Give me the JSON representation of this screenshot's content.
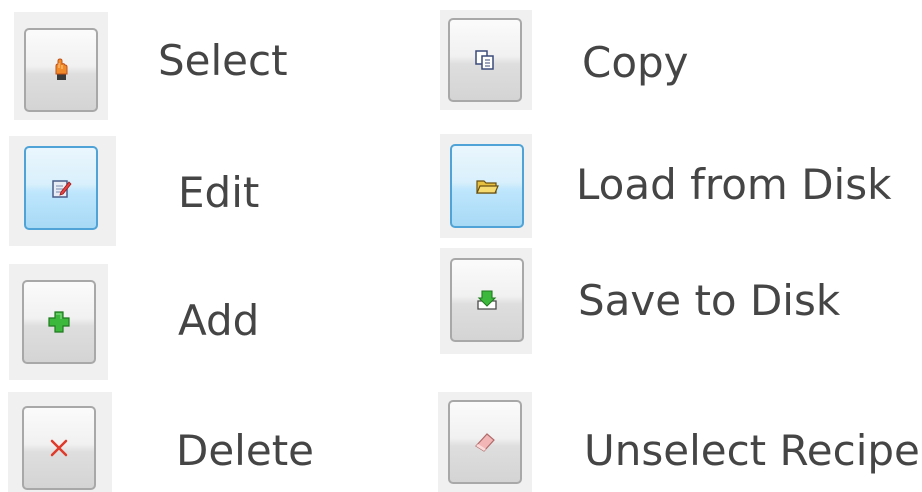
{
  "buttons": [
    {
      "key": "select",
      "label": "Select",
      "icon": "hand-pointer-icon"
    },
    {
      "key": "edit",
      "label": "Edit",
      "icon": "edit-notepad-icon"
    },
    {
      "key": "add",
      "label": "Add",
      "icon": "plus-icon"
    },
    {
      "key": "delete",
      "label": "Delete",
      "icon": "close-x-icon"
    },
    {
      "key": "copy",
      "label": "Copy",
      "icon": "copy-icon"
    },
    {
      "key": "load",
      "label": "Load from Disk",
      "icon": "folder-icon"
    },
    {
      "key": "save",
      "label": "Save to Disk",
      "icon": "save-download-icon"
    },
    {
      "key": "unselect",
      "label": "Unselect Recipe",
      "icon": "eraser-icon"
    }
  ],
  "colors": {
    "label_text": "#454545",
    "highlight_border": "#4fa3d6",
    "add_green": "#3cb93c",
    "delete_red": "#e03a2a"
  }
}
